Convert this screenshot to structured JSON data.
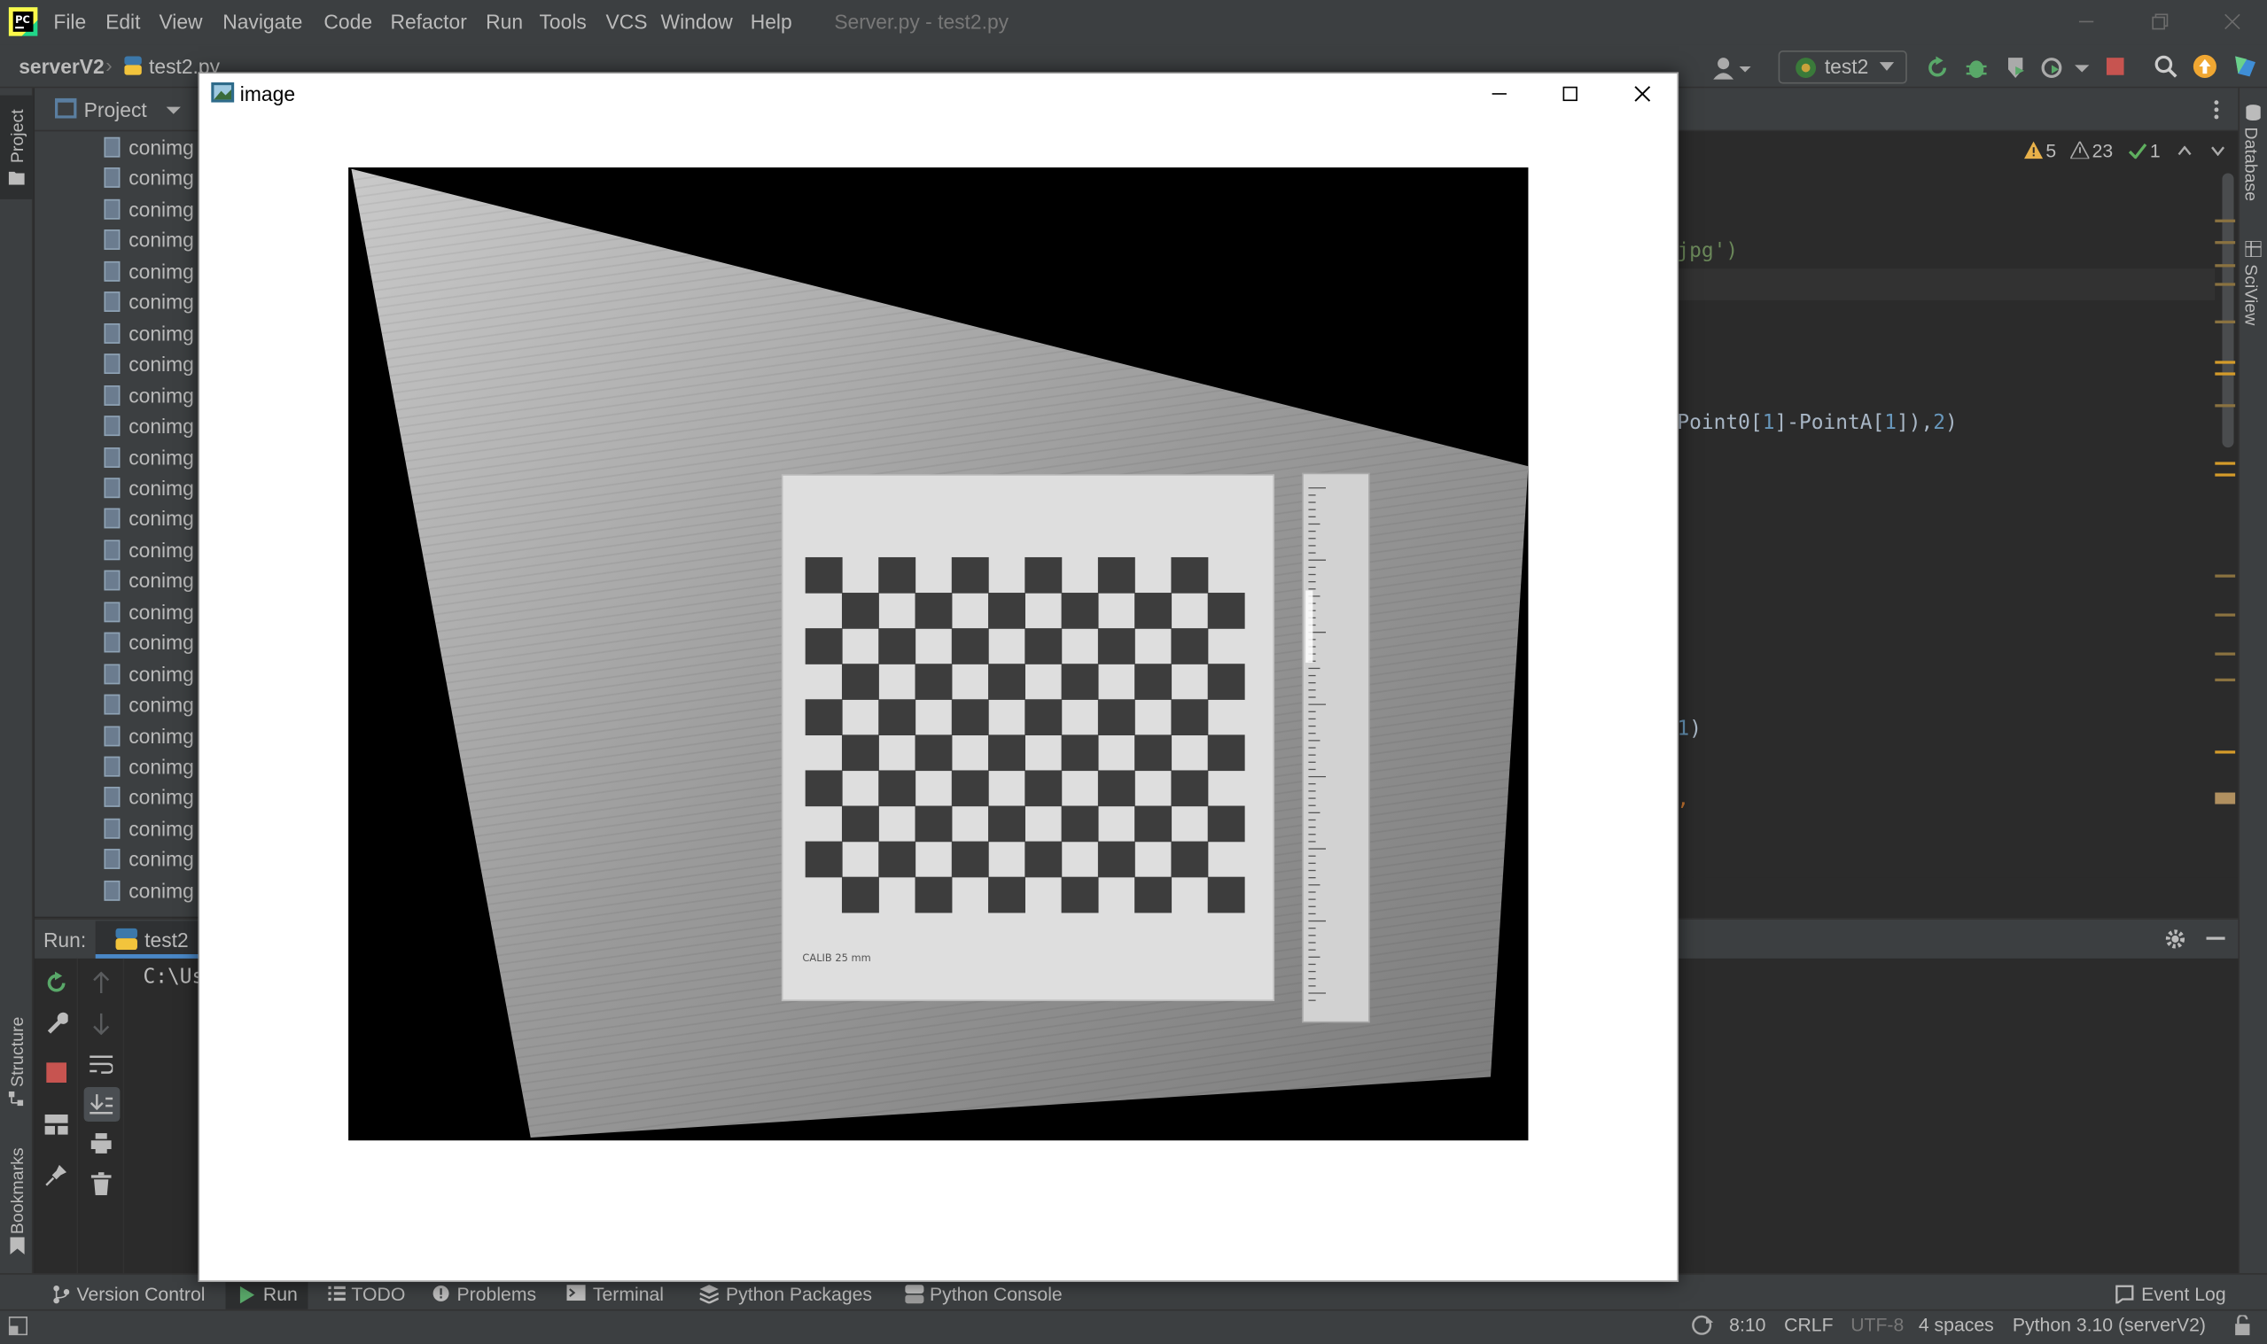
{
  "menubar": {
    "items": [
      "File",
      "Edit",
      "View",
      "Navigate",
      "Code",
      "Refactor",
      "Run",
      "Tools",
      "VCS",
      "Window",
      "Help"
    ],
    "window_title": "Server.py - test2.py"
  },
  "breadcrumb": {
    "project": "serverV2",
    "file": "test2.py",
    "run_config": "test2"
  },
  "project_panel": {
    "title": "Project",
    "file_label": "conimg",
    "file_count": 25
  },
  "inspections": {
    "warnings": "5",
    "weak_warnings": "23",
    "ok": "1"
  },
  "code_fragments": {
    "line_jpg": "jpg')",
    "line_point_a": "Point0[",
    "line_point_b": "1",
    "line_point_c": "]-PointA[",
    "line_point_d": "1",
    "line_point_e": "]),",
    "line_point_f": "2",
    "line_point_g": ")",
    "line_one_a": "1",
    "line_one_b": ")",
    "line_comma": ","
  },
  "side_tools": {
    "left": [
      "Project",
      "Structure",
      "Bookmarks"
    ],
    "right": [
      "Database",
      "SciView"
    ]
  },
  "run_panel": {
    "label": "Run:",
    "tab": "test2",
    "console_text": "C:\\Us"
  },
  "image_window": {
    "title": "image",
    "checker_rows": 10,
    "checker_cols": 12,
    "board_caption": "CALIB 25 mm"
  },
  "bottom_tabs": [
    "Version Control",
    "Run",
    "TODO",
    "Problems",
    "Terminal",
    "Python Packages",
    "Python Console"
  ],
  "event_log": "Event Log",
  "status": {
    "position": "8:10",
    "line_sep": "CRLF",
    "encoding": "UTF-8",
    "indent": "4 spaces",
    "interpreter": "Python 3.10 (serverV2)"
  },
  "colors": {
    "ide_bg": "#2b2b2b",
    "panel_bg": "#3c3f41",
    "warning": "#e8b14a",
    "ok": "#5fb05f",
    "run_green": "#59a869",
    "stop_red": "#c75450"
  }
}
